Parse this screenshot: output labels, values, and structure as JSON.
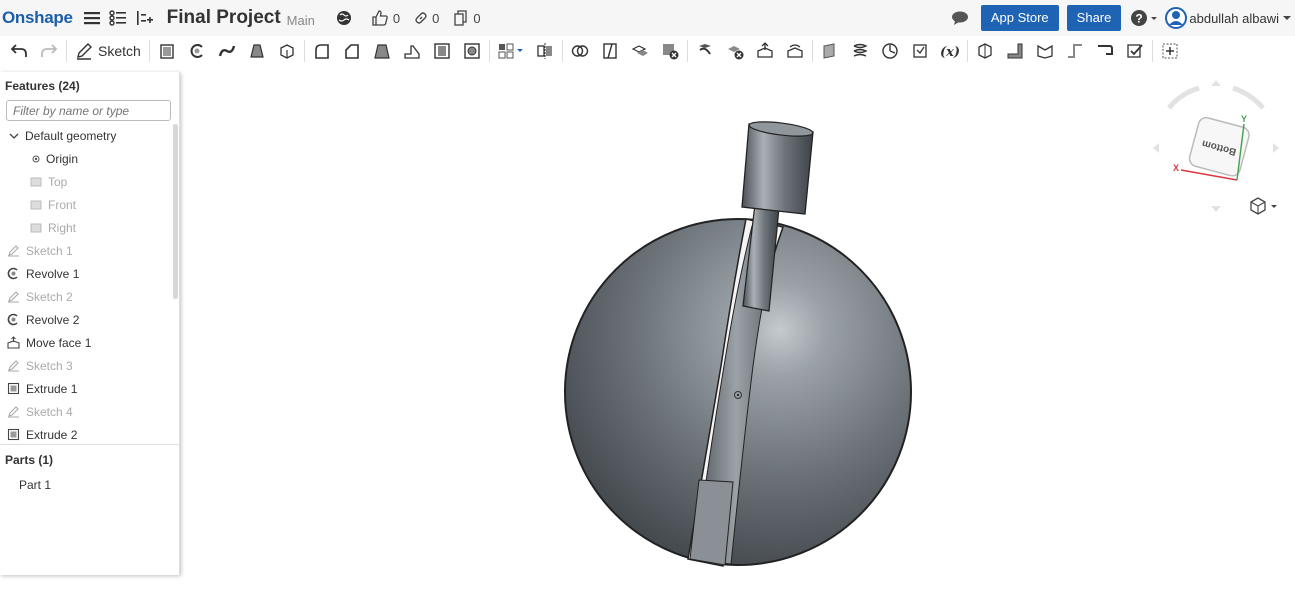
{
  "header": {
    "logo": "Onshape",
    "document_title": "Final Project",
    "workspace": "Main",
    "likes": "0",
    "links": "0",
    "copies": "0",
    "app_store_label": "App Store",
    "share_label": "Share",
    "user_name": "abdullah albawi"
  },
  "toolbar": {
    "sketch_label": "Sketch",
    "icons": [
      "undo-icon",
      "redo-icon",
      "sketch-icon",
      "extrude-icon",
      "revolve-icon",
      "sweep-icon",
      "loft-icon",
      "thicken-icon",
      "fillet-icon",
      "chamfer-icon",
      "draft-icon",
      "rib-icon",
      "shell-icon",
      "hole-icon",
      "pattern-icon",
      "mirror-icon",
      "boolean-icon",
      "split-icon",
      "transform-icon",
      "delete-part-icon",
      "modify-fillet-icon",
      "delete-face-icon",
      "move-face-icon",
      "replace-face-icon",
      "plane-icon",
      "helix-icon",
      "mate-connector-icon",
      "variable-studio-icon",
      "variable-icon",
      "sheet-metal-icon",
      "flange-icon",
      "bend-icon",
      "jog-icon",
      "hem-icon",
      "finish-icon",
      "add-custom-feature-icon"
    ]
  },
  "feature_panel": {
    "features_title": "Features (24)",
    "filter_placeholder": "Filter by name or type",
    "items": [
      {
        "label": "Default geometry",
        "icon": "chevron-down-icon",
        "dim": false
      },
      {
        "label": "Origin",
        "icon": "origin-icon",
        "dim": false
      },
      {
        "label": "Top",
        "icon": "plane-icon",
        "dim": true
      },
      {
        "label": "Front",
        "icon": "plane-icon",
        "dim": true
      },
      {
        "label": "Right",
        "icon": "plane-icon",
        "dim": true
      },
      {
        "label": "Sketch 1",
        "icon": "sketch-icon",
        "dim": true
      },
      {
        "label": "Revolve 1",
        "icon": "revolve-icon",
        "dim": false
      },
      {
        "label": "Sketch 2",
        "icon": "sketch-icon",
        "dim": true
      },
      {
        "label": "Revolve 2",
        "icon": "revolve-icon",
        "dim": false
      },
      {
        "label": "Move face 1",
        "icon": "move-face-icon",
        "dim": false
      },
      {
        "label": "Sketch 3",
        "icon": "sketch-icon",
        "dim": true
      },
      {
        "label": "Extrude 1",
        "icon": "extrude-icon",
        "dim": false
      },
      {
        "label": "Sketch 4",
        "icon": "sketch-icon",
        "dim": true
      },
      {
        "label": "Extrude 2",
        "icon": "extrude-icon",
        "dim": false
      }
    ],
    "parts_title": "Parts (1)",
    "parts": [
      "Part 1"
    ]
  },
  "view_cube": {
    "face_label": "Bottom",
    "x_axis": "X",
    "y_axis": "Y"
  },
  "colors": {
    "brand": "#1c5fa8",
    "button": "#1f63b4",
    "x_axis": "#d9363e",
    "y_axis": "#3fa34d"
  }
}
